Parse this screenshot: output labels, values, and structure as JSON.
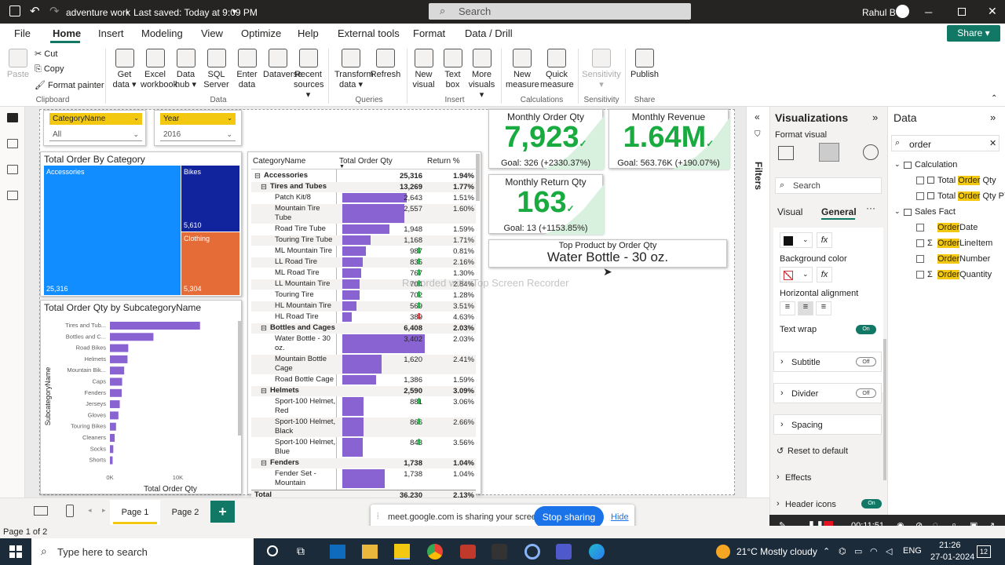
{
  "titlebar": {
    "file_name": "adventure work",
    "saved": "Last saved: Today at 9:09 PM",
    "search_placeholder": "Search",
    "user": "Rahul B"
  },
  "menu": [
    "File",
    "Home",
    "Insert",
    "Modeling",
    "View",
    "Optimize",
    "Help",
    "External tools",
    "Format",
    "Data / Drill"
  ],
  "share_label": "Share",
  "ribbon": {
    "clipboard": {
      "paste": "Paste",
      "cut": "Cut",
      "copy": "Copy",
      "format_painter": "Format painter",
      "group": "Clipboard"
    },
    "data_buttons": [
      {
        "l1": "Get",
        "l2": "data ▾"
      },
      {
        "l1": "Excel",
        "l2": "workbook"
      },
      {
        "l1": "Data",
        "l2": "hub ▾"
      },
      {
        "l1": "SQL",
        "l2": "Server"
      },
      {
        "l1": "Enter",
        "l2": "data"
      },
      {
        "l1": "Dataverse",
        "l2": ""
      },
      {
        "l1": "Recent",
        "l2": "sources ▾"
      }
    ],
    "data_group": "Data",
    "queries_buttons": [
      {
        "l1": "Transform",
        "l2": "data ▾"
      },
      {
        "l1": "Refresh",
        "l2": ""
      }
    ],
    "queries_group": "Queries",
    "insert_buttons": [
      {
        "l1": "New",
        "l2": "visual"
      },
      {
        "l1": "Text",
        "l2": "box"
      },
      {
        "l1": "More",
        "l2": "visuals ▾"
      }
    ],
    "insert_group": "Insert",
    "calc_buttons": [
      {
        "l1": "New",
        "l2": "measure"
      },
      {
        "l1": "Quick",
        "l2": "measure"
      }
    ],
    "calc_group": "Calculations",
    "sens_button": {
      "l1": "Sensitivity",
      "l2": "▾"
    },
    "sens_group": "Sensitivity",
    "publish_button": "Publish",
    "share_group": "Share"
  },
  "slicers": [
    {
      "title": "CategoryName",
      "value": "All"
    },
    {
      "title": "Year",
      "value": "2016"
    }
  ],
  "treemap": {
    "title": "Total Order By Category",
    "cells": [
      {
        "name": "Accessories",
        "value": "25,316",
        "color": "#118dff"
      },
      {
        "name": "Bikes",
        "value": "5,610",
        "color": "#12239e"
      },
      {
        "name": "Clothing",
        "value": "5,304",
        "color": "#e66c37"
      }
    ]
  },
  "barchart": {
    "title": "Total Order Qty by SubcategoryName",
    "ylabel": "SubcategoryName",
    "xlabel": "Total Order Qty",
    "ticks": [
      "0K",
      "10K"
    ]
  },
  "chart_data": {
    "type": "bar",
    "title": "Total Order Qty by SubcategoryName",
    "xlabel": "Total Order Qty",
    "ylabel": "SubcategoryName",
    "categories": [
      "Tires and Tub...",
      "Bottles and C...",
      "Road Bikes",
      "Helmets",
      "Mountain Bik...",
      "Caps",
      "Fenders",
      "Jerseys",
      "Gloves",
      "Touring Bikes",
      "Cleaners",
      "Socks",
      "Shorts"
    ],
    "values": [
      13269,
      6408,
      2700,
      2590,
      2100,
      1800,
      1738,
      1450,
      1250,
      900,
      700,
      500,
      400
    ],
    "xlim": [
      0,
      17000
    ],
    "color": "#8a63d2"
  },
  "matrix": {
    "headers": [
      "CategoryName",
      "Total Order Qty",
      "Return %"
    ],
    "max": 3500,
    "rows": [
      {
        "name": "Accessories",
        "qty": "25,316",
        "ret": "1.94%",
        "level": 0,
        "sym": "⊟"
      },
      {
        "name": "Tires and Tubes",
        "qty": "13,269",
        "ret": "1.77%",
        "level": 1,
        "sym": "⊟"
      },
      {
        "name": "Patch Kit/8",
        "qty": "2,643",
        "v": 2643,
        "ret": "1.51%",
        "level": 2
      },
      {
        "name": "Mountain Tire Tube",
        "qty": "2,557",
        "v": 2557,
        "ret": "1.60%",
        "level": 2,
        "tall": true
      },
      {
        "name": "Road Tire Tube",
        "qty": "1,948",
        "v": 1948,
        "ret": "1.59%",
        "level": 2
      },
      {
        "name": "Touring Tire Tube",
        "qty": "1,168",
        "v": 1168,
        "ret": "1.71%",
        "level": 2
      },
      {
        "name": "ML Mountain Tire",
        "qty": "987",
        "v": 987,
        "ret": "0.81%",
        "level": 2,
        "arrow": "up"
      },
      {
        "name": "LL Road Tire",
        "qty": "835",
        "v": 835,
        "ret": "2.16%",
        "level": 2,
        "arrow": "up"
      },
      {
        "name": "ML Road Tire",
        "qty": "767",
        "v": 767,
        "ret": "1.30%",
        "level": 2,
        "arrow": "up"
      },
      {
        "name": "LL Mountain Tire",
        "qty": "704",
        "v": 704,
        "ret": "2.84%",
        "level": 2,
        "arrow": "up"
      },
      {
        "name": "Touring Tire",
        "qty": "702",
        "v": 702,
        "ret": "1.28%",
        "level": 2,
        "arrow": "up"
      },
      {
        "name": "HL Mountain Tire",
        "qty": "569",
        "v": 569,
        "ret": "3.51%",
        "level": 2,
        "arrow": "up"
      },
      {
        "name": "HL Road Tire",
        "qty": "389",
        "v": 389,
        "ret": "4.63%",
        "level": 2,
        "arrow": "dn"
      },
      {
        "name": "Bottles and Cages",
        "qty": "6,408",
        "ret": "2.03%",
        "level": 1,
        "sym": "⊟"
      },
      {
        "name": "Water Bottle - 30 oz.",
        "qty": "3,402",
        "v": 3402,
        "ret": "2.03%",
        "level": 2,
        "tall": true
      },
      {
        "name": "Mountain Bottle Cage",
        "qty": "1,620",
        "v": 1620,
        "ret": "2.41%",
        "level": 2,
        "tall": true
      },
      {
        "name": "Road Bottle Cage",
        "qty": "1,386",
        "v": 1386,
        "ret": "1.59%",
        "level": 2
      },
      {
        "name": "Helmets",
        "qty": "2,590",
        "ret": "3.09%",
        "level": 1,
        "sym": "⊟"
      },
      {
        "name": "Sport-100 Helmet, Red",
        "qty": "881",
        "v": 881,
        "ret": "3.06%",
        "level": 2,
        "tall": true,
        "arrow": "up"
      },
      {
        "name": "Sport-100 Helmet, Black",
        "qty": "866",
        "v": 866,
        "ret": "2.66%",
        "level": 2,
        "tall": true,
        "arrow": "up"
      },
      {
        "name": "Sport-100 Helmet, Blue",
        "qty": "843",
        "v": 843,
        "ret": "3.56%",
        "level": 2,
        "tall": true,
        "arrow": "up"
      },
      {
        "name": "Fenders",
        "qty": "1,738",
        "ret": "1.04%",
        "level": 1,
        "sym": "⊟"
      },
      {
        "name": "Fender Set - Mountain",
        "qty": "1,738",
        "v": 1738,
        "ret": "1.04%",
        "level": 2,
        "tall": true
      },
      {
        "name": "Total",
        "qty": "36,230",
        "ret": "2.13%",
        "level": 0,
        "total": true
      }
    ]
  },
  "kpis": [
    {
      "title": "Monthly Order Qty",
      "value": "7,923",
      "goal": "Goal: 326 (+2330.37%)"
    },
    {
      "title": "Monthly Revenue",
      "value": "1.64M",
      "goal": "Goal: 563.76K (+190.07%)"
    },
    {
      "title": "Monthly Return Qty",
      "value": "163",
      "goal": "Goal: 13 (+1153.85%)"
    }
  ],
  "topproduct": {
    "title": "Top Product by Order Qty",
    "value": "Water Bottle - 30 oz."
  },
  "watermark": "Recorded with iTop Screen Recorder",
  "filters_label": "Filters",
  "vispane": {
    "title": "Visualizations",
    "format_visual": "Format visual",
    "search": "Search",
    "tabs": [
      "Visual",
      "General"
    ],
    "background_color": "Background color",
    "horizontal_alignment": "Horizontal alignment",
    "text_wrap": "Text wrap",
    "on": "On",
    "off": "Off",
    "sections": [
      "Subtitle",
      "Divider",
      "Spacing"
    ],
    "reset": "Reset to default",
    "effects": "Effects",
    "header_icons": "Header icons",
    "fx": "fx"
  },
  "datapane": {
    "title": "Data",
    "search_value": "order",
    "tables": [
      {
        "name": "Calculation",
        "fields": [
          {
            "pre": "Total ",
            "hl": "Order",
            "post": " Qty"
          },
          {
            "pre": "Total ",
            "hl": "Order",
            "post": " Qty PY"
          }
        ]
      },
      {
        "name": "Sales Fact",
        "fields": [
          {
            "pre": "",
            "hl": "Order",
            "post": "Date",
            "sigma": false
          },
          {
            "pre": "",
            "hl": "Order",
            "post": "LineItem",
            "sigma": true
          },
          {
            "pre": "",
            "hl": "Order",
            "post": "Number",
            "sigma": false
          },
          {
            "pre": "",
            "hl": "Order",
            "post": "Quantity",
            "sigma": true
          }
        ]
      }
    ]
  },
  "pages": [
    "Page 1",
    "Page 2"
  ],
  "status": "Page 1 of 2",
  "sharebar": {
    "text": "meet.google.com is sharing your screen.",
    "stop": "Stop sharing",
    "hide": "Hide"
  },
  "recorder": {
    "time": "00:11:51"
  },
  "taskbar": {
    "search": "Type here to search",
    "weather": "21°C  Mostly cloudy",
    "lang": "ENG",
    "time": "21:26",
    "date": "27-01-2024",
    "notif": "12"
  }
}
